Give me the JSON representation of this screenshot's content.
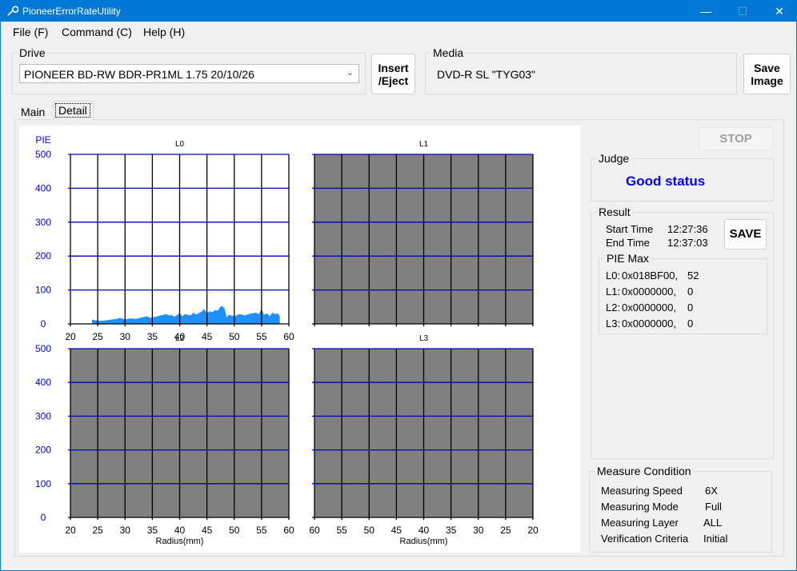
{
  "window": {
    "title": "PioneerErrorRateUtility",
    "controls": {
      "minimize": "—",
      "maximize": "☐",
      "close": "✕"
    }
  },
  "menu": [
    {
      "label": "File (F)",
      "id": "file"
    },
    {
      "label": "Command (C)",
      "id": "command"
    },
    {
      "label": "Help (H)",
      "id": "help"
    }
  ],
  "drive": {
    "group_label": "Drive",
    "selected": "PIONEER BD-RW BDR-PR1ML 1.75 20/10/26",
    "insert_eject_label_line1": "Insert",
    "insert_eject_label_line2": "/Eject"
  },
  "media": {
    "group_label": "Media",
    "value": "DVD-R SL \"TYG03\""
  },
  "save_image": {
    "line1": "Save",
    "line2": "Image"
  },
  "tabs": [
    {
      "label": "Main",
      "active": false
    },
    {
      "label": "Detail",
      "active": true
    }
  ],
  "stop_label": "STOP",
  "judge": {
    "group_label": "Judge",
    "status": "Good status",
    "status_color": "#0000ff"
  },
  "result": {
    "group_label": "Result",
    "start_time_label": "Start Time",
    "start_time": "12:27:36",
    "end_time_label": "End Time",
    "end_time": "12:37:03",
    "save_label": "SAVE",
    "pie_max": {
      "group_label": "PIE Max",
      "rows": [
        {
          "layer": "L0:",
          "address": "0x018BF00,",
          "value": "52"
        },
        {
          "layer": "L1:",
          "address": "0x0000000,",
          "value": "0"
        },
        {
          "layer": "L2:",
          "address": "0x0000000,",
          "value": "0"
        },
        {
          "layer": "L3:",
          "address": "0x0000000,",
          "value": "0"
        }
      ]
    }
  },
  "measure_condition": {
    "group_label": "Measure Condition",
    "rows": [
      {
        "label": "Measuring Speed",
        "value": "6X"
      },
      {
        "label": "Measuring Mode",
        "value": "Full"
      },
      {
        "label": "Measuring Layer",
        "value": "ALL"
      },
      {
        "label": "Verification Criteria",
        "value": "Initial"
      }
    ]
  },
  "chart_data": [
    {
      "type": "area",
      "title": "L0",
      "ylabel": "PIE",
      "xlabel": "",
      "xlim": [
        20,
        60
      ],
      "ylim": [
        0,
        500
      ],
      "x_ticks": [
        "20",
        "25",
        "30",
        "35",
        "40",
        "45",
        "50",
        "55",
        "60"
      ],
      "y_ticks": [
        "0",
        "100",
        "200",
        "300",
        "400",
        "500"
      ],
      "grid": true,
      "plot_background": "#ffffff",
      "fill_color": "#1e90ff",
      "has_data": true,
      "series": [
        {
          "name": "PIE",
          "x": [
            24.0,
            24.5,
            25.5,
            26.5,
            27.5,
            28.5,
            29.0,
            30.0,
            31.0,
            32.0,
            33.0,
            34.0,
            34.5,
            35.5,
            36.5,
            37.5,
            38.0,
            38.5,
            39.0,
            40.0,
            40.5,
            41.0,
            42.0,
            42.5,
            43.0,
            44.0,
            44.5,
            45.0,
            45.5,
            46.0,
            46.5,
            47.0,
            47.5,
            47.8,
            48.2,
            48.6,
            49.0,
            50.0,
            51.0,
            52.0,
            53.0,
            54.0,
            54.5,
            55.0,
            55.4,
            56.0,
            56.5,
            57.0,
            57.5,
            58.0,
            58.3
          ],
          "values": [
            12,
            10,
            8,
            10,
            12,
            14,
            17,
            13,
            15,
            14,
            18,
            22,
            17,
            20,
            24,
            28,
            24,
            26,
            20,
            30,
            22,
            28,
            24,
            32,
            27,
            35,
            43,
            30,
            36,
            34,
            40,
            38,
            50,
            52,
            44,
            18,
            26,
            22,
            28,
            24,
            30,
            32,
            28,
            42,
            26,
            30,
            22,
            32,
            28,
            30,
            22
          ]
        }
      ]
    },
    {
      "type": "area",
      "title": "L1",
      "xlim": [
        60,
        20
      ],
      "ylim": [
        0,
        500
      ],
      "x_ticks": [],
      "y_ticks": [],
      "grid": true,
      "plot_background": "#808080",
      "has_data": false,
      "series": []
    },
    {
      "type": "area",
      "title": "L2",
      "xlabel": "Radius(mm)",
      "xlim": [
        20,
        60
      ],
      "ylim": [
        0,
        500
      ],
      "x_ticks": [
        "20",
        "25",
        "30",
        "35",
        "40",
        "45",
        "50",
        "55",
        "60"
      ],
      "y_ticks": [
        "0",
        "100",
        "200",
        "300",
        "400",
        "500"
      ],
      "grid": true,
      "plot_background": "#808080",
      "has_data": false,
      "series": []
    },
    {
      "type": "area",
      "title": "L3",
      "xlabel": "Radius(mm)",
      "xlim": [
        60,
        20
      ],
      "ylim": [
        0,
        500
      ],
      "x_ticks": [
        "60",
        "55",
        "50",
        "45",
        "40",
        "35",
        "30",
        "25",
        "20"
      ],
      "y_ticks": [],
      "grid": true,
      "plot_background": "#808080",
      "has_data": false,
      "series": []
    }
  ]
}
